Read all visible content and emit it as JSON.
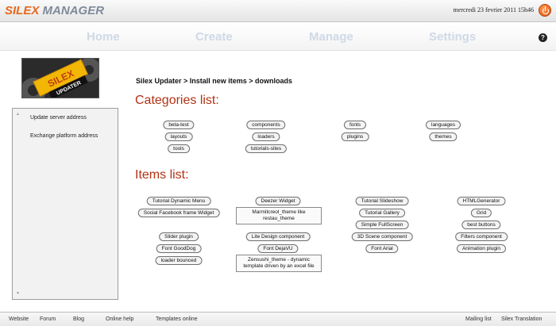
{
  "header": {
    "logo_part1": "SILEX",
    "logo_part2": "MANAGER",
    "datetime": "mercredi 23 fevrier 2011 15h46"
  },
  "nav": {
    "items": [
      "Home",
      "Create",
      "Manage",
      "Settings"
    ],
    "help": "?"
  },
  "sidebar": {
    "logo_text": "SILEX UPDATER",
    "items": [
      "Update server address",
      "Exchange platform address"
    ]
  },
  "main": {
    "breadcrumb": "Silex Updater > Install new items > downloads",
    "categories_title": "Categories list:",
    "categories": [
      "beta-test",
      "components",
      "fonts",
      "languages",
      "layouts",
      "loaders",
      "plugins",
      "themes",
      "tools",
      "tutorials-sites"
    ],
    "items_title": "Items list:",
    "items": [
      "Tutorial Dynamic Menu",
      "Deezer Widget",
      "Tutorial Slideshow",
      "HTMLGenerator",
      "Social Facebook frame Widget",
      "Marmitcreol_theme like restau_theme",
      "Tutorial Gallery",
      "Grid",
      "Simple FullScreen",
      "best buttons",
      "Slider plugin",
      "Lite Design component",
      "3D Scene component",
      "Filters component",
      "Font GoodDog",
      "Font DejaVU",
      "Font Arial",
      "Animation plugin",
      "loader bounced",
      "Zensushi_theme - dynamic template driven by an excel file"
    ]
  },
  "footer": {
    "left_links": [
      "Website",
      "Forum",
      "Blog",
      "Online help",
      "Templates online"
    ],
    "right_links": [
      "Mailing list",
      "Silex Translation"
    ]
  },
  "colors": {
    "accent": "#e8681c",
    "section_title": "#b23214",
    "nav_text": "#cfd9e6"
  }
}
